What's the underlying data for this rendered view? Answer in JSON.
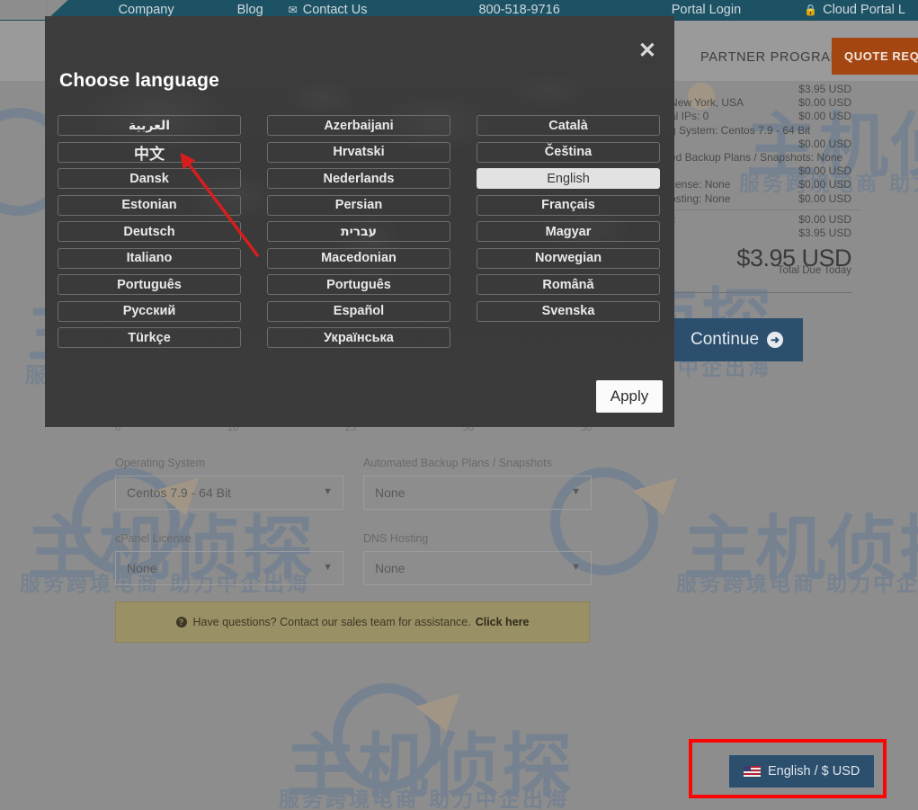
{
  "topnav": {
    "items": [
      {
        "label": "Company",
        "icon": null
      },
      {
        "label": "Blog",
        "icon": null
      },
      {
        "label": "Contact Us",
        "icon": "envelope-icon"
      },
      {
        "label": "800-518-9716",
        "icon": null
      },
      {
        "label": "Portal Login",
        "icon": null
      },
      {
        "label": "Cloud Portal L",
        "icon": "lock-icon"
      }
    ]
  },
  "header": {
    "partner_program": "PARTNER PROGRAM",
    "quote_button": "QUOTE REQU"
  },
  "summary": {
    "rows": [
      {
        "label": "",
        "amount": "$3.95 USD"
      },
      {
        "label": "New York, USA",
        "amount": "$0.00 USD"
      },
      {
        "label": "al IPs: 0",
        "amount": "$0.00 USD"
      },
      {
        "label": "g System: Centos 7.9 - 64 Bit",
        "amount": ""
      },
      {
        "label": "",
        "amount": "$0.00 USD"
      },
      {
        "label": "ed Backup Plans / Snapshots: None",
        "amount": ""
      },
      {
        "label": "",
        "amount": "$0.00 USD"
      },
      {
        "label": "cense: None",
        "amount": "$0.00 USD"
      },
      {
        "label": "osting: None",
        "amount": "$0.00 USD"
      }
    ],
    "footer_rows": [
      {
        "label": "t:",
        "amount": "$0.00 USD"
      },
      {
        "label": "",
        "amount": "$3.95 USD"
      }
    ],
    "total": "$3.95 USD",
    "total_caption": "Total Due Today",
    "continue_label": "Continue",
    "continue_icon": "arrow-right-icon"
  },
  "slider": {
    "ticks": [
      "0",
      "10",
      "25",
      "50",
      "50"
    ]
  },
  "form": {
    "fields": [
      {
        "label": "Operating System",
        "value": "Centos 7.9 - 64 Bit"
      },
      {
        "label": "Automated Backup Plans / Snapshots",
        "value": "None"
      },
      {
        "label": "cPanel License",
        "value": "None"
      },
      {
        "label": "DNS Hosting",
        "value": "None"
      }
    ]
  },
  "help_banner": {
    "icon": "question-circle-icon",
    "text": "Have questions? Contact our sales team for assistance.",
    "link": "Click here"
  },
  "lang_currency": {
    "flag": "us-flag-icon",
    "label": "English / $ USD"
  },
  "modal": {
    "title": "Choose language",
    "close_icon": "close-icon",
    "apply_label": "Apply",
    "active_language": "English",
    "columns": [
      [
        "العربية",
        "中文",
        "Dansk",
        "Estonian",
        "Deutsch",
        "Italiano",
        "Português",
        "Русский",
        "Türkçe"
      ],
      [
        "Azerbaijani",
        "Hrvatski",
        "Nederlands",
        "Persian",
        "עברית",
        "Macedonian",
        "Português",
        "Español",
        "Українська"
      ],
      [
        "Català",
        "Čeština",
        "English",
        "Français",
        "Magyar",
        "Norwegian",
        "Română",
        "Svenska"
      ]
    ]
  },
  "watermark": {
    "big_text": "主机侦探",
    "small_text": "服务跨境电商  助力中企出海"
  }
}
